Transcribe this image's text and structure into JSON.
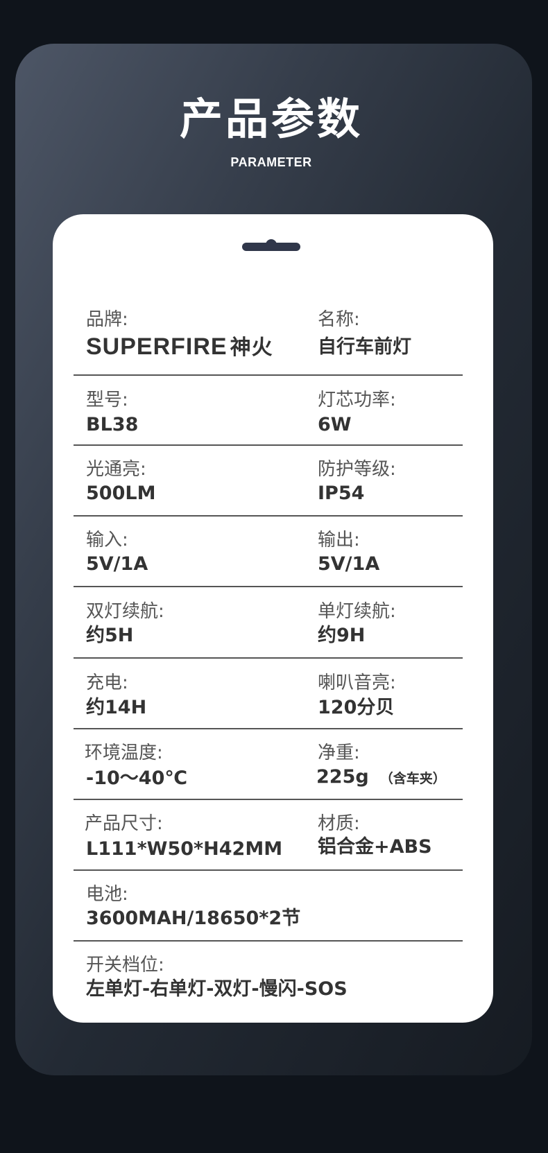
{
  "header": {
    "title": "产品参数",
    "subtitle": "PARAMETER"
  },
  "brand": {
    "label": "品牌:",
    "value_latin": "SUPERFIRE",
    "value_cn": "神火"
  },
  "name": {
    "label": "名称:",
    "value": "自行车前灯"
  },
  "model": {
    "label": "型号:",
    "value": "BL38"
  },
  "power": {
    "label": "灯芯功率:",
    "value": "6W"
  },
  "lumen": {
    "label": "光通亮:",
    "value": "500LM"
  },
  "protection": {
    "label": "防护等级:",
    "value": "IP54"
  },
  "input": {
    "label": "输入:",
    "value": "5V/1A"
  },
  "output": {
    "label": "输出:",
    "value": "5V/1A"
  },
  "dual_runtime": {
    "label": "双灯续航:",
    "value": "约5H"
  },
  "single_runtime": {
    "label": "单灯续航:",
    "value": "约9H"
  },
  "charge": {
    "label": "充电:",
    "value": "约14H"
  },
  "horn": {
    "label": "喇叭音亮:",
    "value": "120分贝"
  },
  "temperature": {
    "label": "环境温度:",
    "value": "-10～40℃"
  },
  "weight": {
    "label": "净重:",
    "value": "225g",
    "note": "（含车夹）"
  },
  "size": {
    "label": "产品尺寸:",
    "value": "L111*W50*H42MM"
  },
  "material": {
    "label": "材质:",
    "value": "铝合金+ABS"
  },
  "battery": {
    "label": "电池:",
    "value": "3600MAH/18650*2节"
  },
  "modes": {
    "label": "开关档位:",
    "value": "左单灯-右单灯-双灯-慢闪-SOS"
  },
  "colors": {
    "background": "#0f141b",
    "card": "#ffffff",
    "label_text": "#555555",
    "value_text": "#333333",
    "hanger": "#30374a"
  }
}
